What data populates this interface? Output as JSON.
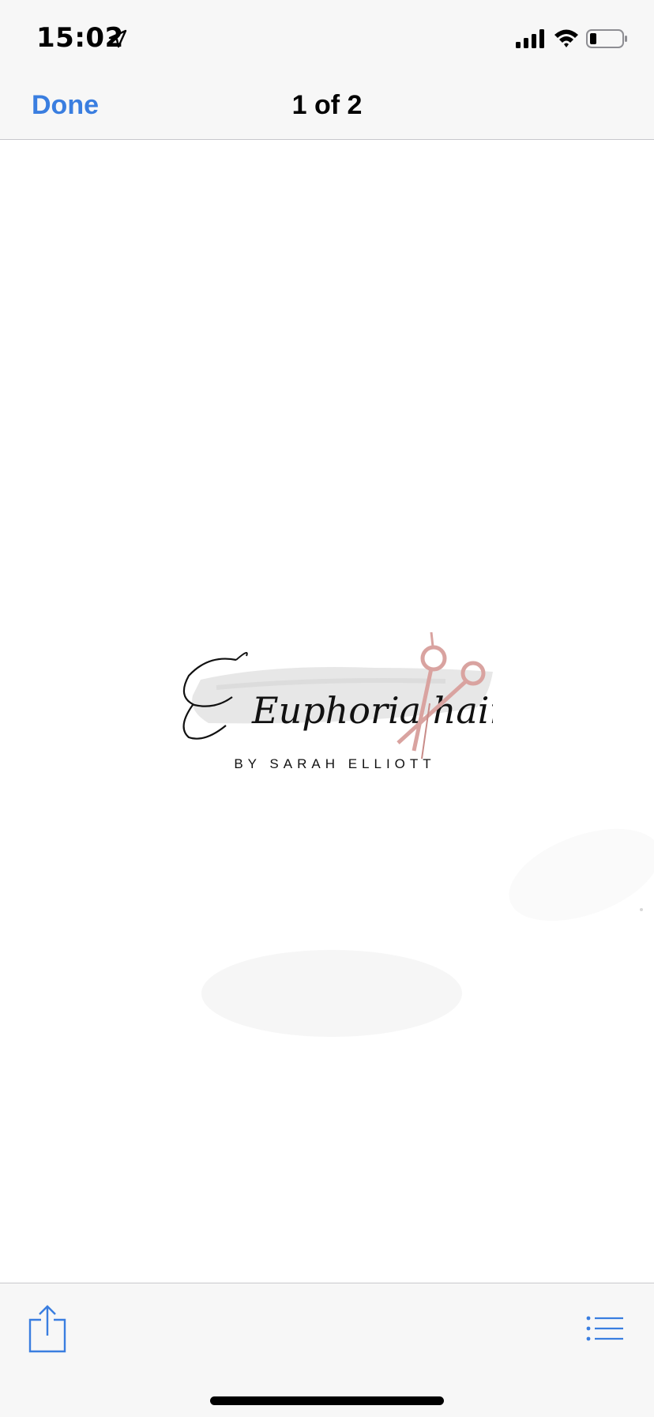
{
  "status_bar": {
    "time": "15:02",
    "icons": [
      "location-arrow-icon",
      "cellular-signal-icon",
      "wifi-icon",
      "battery-icon"
    ]
  },
  "nav": {
    "done_label": "Done",
    "page_counter": "1 of 2"
  },
  "document": {
    "logo": {
      "script_text": "Euphoria hair",
      "tagline": "BY SARAH ELLIOTT",
      "icon": "scissors-icon"
    }
  },
  "toolbar": {
    "icons": [
      "share-icon",
      "list-icon"
    ]
  },
  "colors": {
    "accent": "#3a7ee0",
    "bar_background": "#f7f7f7",
    "scissors_rose_gold": "#d9a3a0"
  }
}
